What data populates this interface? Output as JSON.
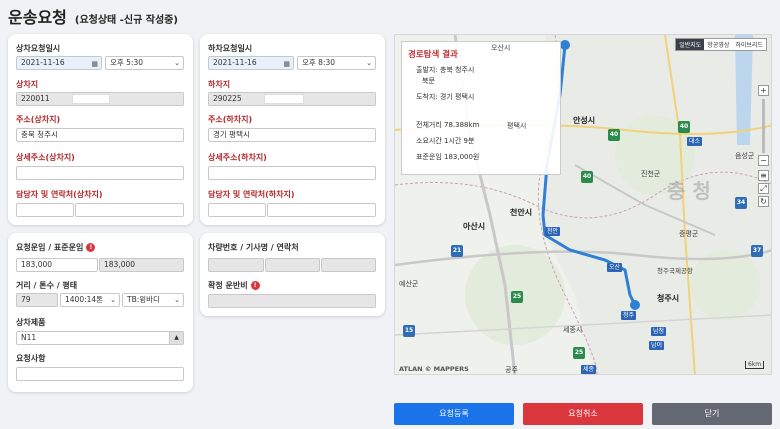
{
  "page": {
    "title": "운송요청",
    "subtitle": "(요청상태 -신규 작성중)"
  },
  "loading": {
    "datetime_label": "상차요청일시",
    "date": "2021-11-16",
    "time": "오후 5:30",
    "site_label": "상차지",
    "site_code": "220011",
    "addr_label": "주소(상차지)",
    "addr": "충북 청주시",
    "detail_label": "상세주소(상차지)",
    "detail": "",
    "contact_label": "담당자 및 연락처(상차지)"
  },
  "unloading": {
    "datetime_label": "하차요청일시",
    "date": "2021-11-16",
    "time": "오후 8:30",
    "site_label": "하차지",
    "site_code": "290225",
    "addr_label": "주소(하차지)",
    "addr": "경기 평택시",
    "detail_label": "상세주소(하차지)",
    "detail": "",
    "contact_label": "담당자 및 연락처(하차지)"
  },
  "fare": {
    "label": "요청운임 / 표준운임",
    "requested": "183,000",
    "standard": "183,000",
    "dist_label": "거리 / 톤수 / 평태",
    "distance": "79",
    "tonnage": "1400:14톤",
    "body_type": "TB:윙바디",
    "product_label": "상차제품",
    "product": "N11",
    "request_label": "요청사항",
    "request": ""
  },
  "vehicle": {
    "label": "차량번호 / 기사명 / 연락처",
    "fixed_fare_label": "확정 운반비"
  },
  "route": {
    "title": "경로탐색 결과",
    "origin": "출발지: 충북 청주시",
    "origin_line2": "북문",
    "destination": "도착지: 경기 평택시",
    "distance": "전체거리 78.388km",
    "duration": "소요시간 1시간 9분",
    "fare": "표준운임 183,000원"
  },
  "map": {
    "tabs": [
      "일반지도",
      "항공영상",
      "하이브리드"
    ],
    "active_tab": "일반지도",
    "attribution": "ATLAN  © MAPPERS",
    "scale": "6km",
    "places": {
      "anseong": "안성시",
      "cheonan": "천안시",
      "asan": "아산시",
      "cheongju": "청주시",
      "region": "충 청",
      "osan": "오산시",
      "pyeongtaek": "평택시",
      "eumseong": "음성군",
      "jincheon": "진천군",
      "jeungpyeong": "증평군",
      "yesan": "예산군",
      "sejong": "세종시",
      "gongju": "공주"
    },
    "highway_labels": [
      "40",
      "40",
      "40",
      "25",
      "25",
      "21",
      "15",
      "34",
      "37"
    ],
    "ic_labels": [
      "천안",
      "오산",
      "대소",
      "청주",
      "남이",
      "남청",
      "세종"
    ],
    "airport": "청주국제공항"
  },
  "buttons": {
    "submit": "요청등록",
    "cancel": "요청취소",
    "close": "닫기"
  },
  "colors": {
    "submit": "#1a73e8",
    "cancel": "#d9363e",
    "close": "#636873",
    "label_red": "#b0282a",
    "route": "#2e7fd6"
  }
}
